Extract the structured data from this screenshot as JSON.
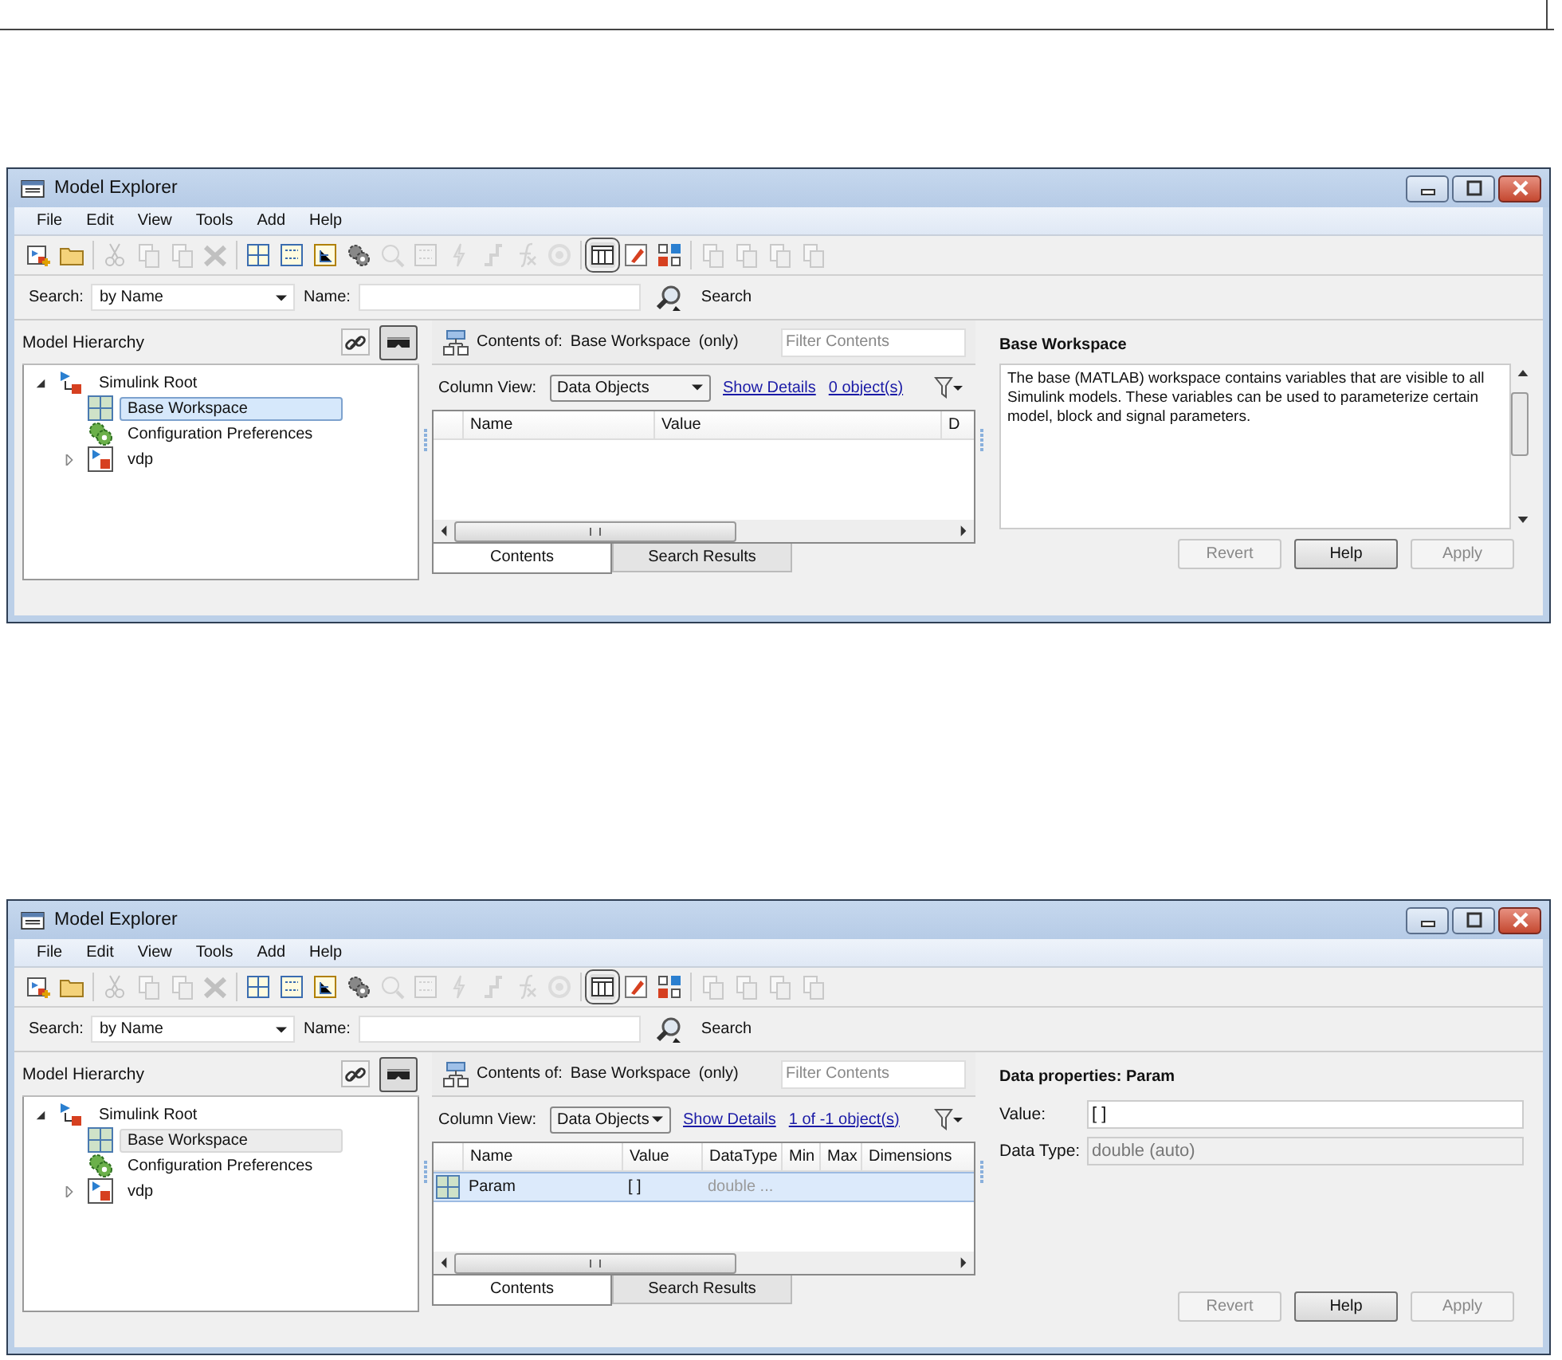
{
  "windows": [
    {
      "title": "Model Explorer",
      "menu": [
        "File",
        "Edit",
        "View",
        "Tools",
        "Add",
        "Help"
      ],
      "search": {
        "label": "Search:",
        "mode": "by Name",
        "name_label": "Name:",
        "button": "Search"
      },
      "hierarchy": {
        "title": "Model Hierarchy",
        "focused": true,
        "tree": [
          {
            "label": "Simulink Root",
            "kind": "root",
            "expanded": true,
            "selected": false,
            "children": [
              {
                "label": "Base Workspace",
                "kind": "workspace",
                "selected": true
              },
              {
                "label": "Configuration Preferences",
                "kind": "config",
                "selected": false
              },
              {
                "label": "vdp",
                "kind": "model",
                "selected": false,
                "expanded": false
              }
            ]
          }
        ]
      },
      "contents": {
        "label": "Contents of:",
        "scope": "Base Workspace",
        "scope_note": "(only)",
        "filter_placeholder": "Filter Contents",
        "column_view_label": "Column View:",
        "column_view": "Data Objects",
        "show_details": "Show Details",
        "count": "0 object(s)",
        "columns": [
          "Name",
          "Value",
          "D"
        ],
        "tabs": [
          {
            "label": "Contents",
            "selected": true
          },
          {
            "label": "Search Results",
            "selected": false
          }
        ]
      },
      "panel": {
        "kind": "description",
        "title": "Base Workspace",
        "text": "The base (MATLAB) workspace contains variables that are visible to all Simulink models. These variables can be used to parameterize certain model, block and signal parameters."
      },
      "buttons": [
        {
          "label": "Revert",
          "disabled": true
        },
        {
          "label": "Help",
          "disabled": false
        },
        {
          "label": "Apply",
          "disabled": true
        }
      ]
    },
    {
      "title": "Model Explorer",
      "menu": [
        "File",
        "Edit",
        "View",
        "Tools",
        "Add",
        "Help"
      ],
      "search": {
        "label": "Search:",
        "mode": "by Name",
        "name_label": "Name:",
        "button": "Search"
      },
      "hierarchy": {
        "title": "Model Hierarchy",
        "focused": false,
        "tree": [
          {
            "label": "Simulink Root",
            "kind": "root",
            "expanded": true,
            "selected": false,
            "children": [
              {
                "label": "Base Workspace",
                "kind": "workspace",
                "selected": true
              },
              {
                "label": "Configuration Preferences",
                "kind": "config",
                "selected": false
              },
              {
                "label": "vdp",
                "kind": "model",
                "selected": false,
                "expanded": false
              }
            ]
          }
        ]
      },
      "contents": {
        "label": "Contents of:",
        "scope": "Base Workspace",
        "scope_note": "(only)",
        "filter_placeholder": "Filter Contents",
        "column_view_label": "Column View:",
        "column_view": "Data Objects",
        "show_details": "Show Details",
        "count": "1 of -1 object(s)",
        "columns": [
          "Name",
          "Value",
          "DataType",
          "Min",
          "Max",
          "Dimensions"
        ],
        "rows": [
          {
            "cells": [
              "Param",
              "[ ]",
              "double ..."
            ],
            "selected": true
          }
        ],
        "tabs": [
          {
            "label": "Contents",
            "selected": true
          },
          {
            "label": "Search Results",
            "selected": false
          }
        ]
      },
      "panel": {
        "kind": "properties",
        "title": "Data properties: Param",
        "fields": [
          {
            "label": "Value:",
            "value": "[ ]",
            "disabled": false
          },
          {
            "label": "Data Type:",
            "value": "double (auto)",
            "disabled": true
          }
        ]
      },
      "buttons": [
        {
          "label": "Revert",
          "disabled": true
        },
        {
          "label": "Help",
          "disabled": false
        },
        {
          "label": "Apply",
          "disabled": true
        }
      ]
    }
  ]
}
